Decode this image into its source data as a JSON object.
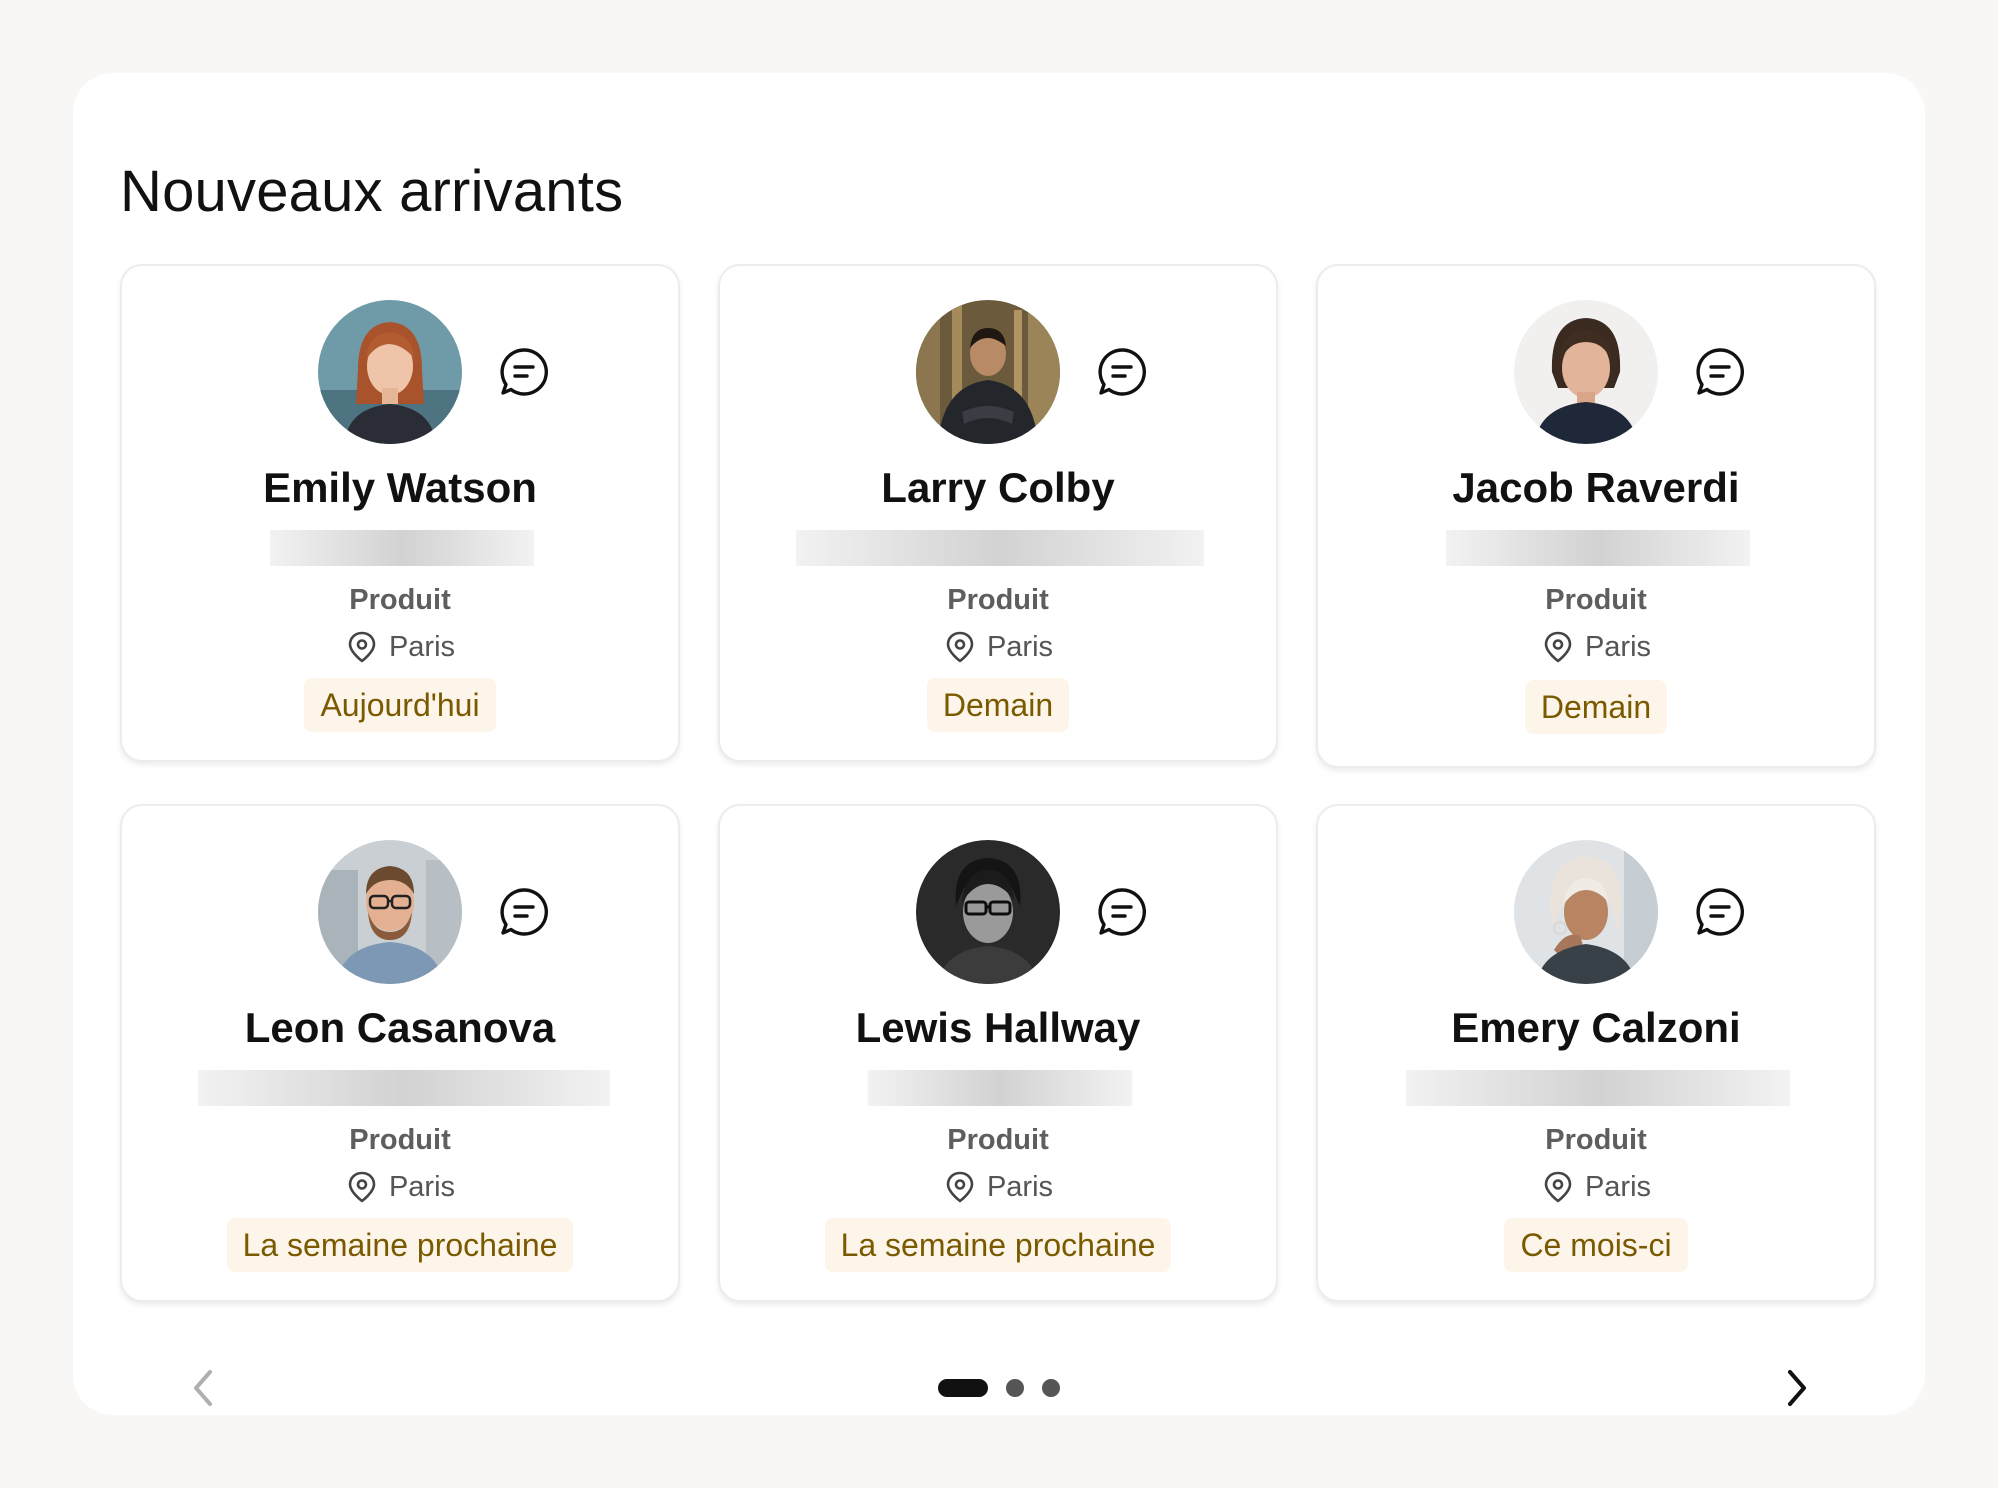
{
  "section_title": "Nouveaux arrivants",
  "colors": {
    "page_background": "#f8f7f5",
    "badge_background": "#fdf5e9",
    "badge_text": "#7a5a00",
    "active_dot": "#111111",
    "inactive_dot": "#555555"
  },
  "icons": {
    "message": "chat-bubble-icon",
    "location": "map-pin-icon",
    "previous": "chevron-left-icon",
    "next": "chevron-right-icon"
  },
  "cards": [
    {
      "name": "Emily Watson",
      "department": "Produit",
      "location": "Paris",
      "start": "Aujourd'hui"
    },
    {
      "name": "Larry Colby",
      "department": "Produit",
      "location": "Paris",
      "start": "Demain"
    },
    {
      "name": "Jacob Raverdi",
      "department": "Produit",
      "location": "Paris",
      "start": "Demain"
    },
    {
      "name": "Leon Casanova",
      "department": "Produit",
      "location": "Paris",
      "start": "La semaine prochaine"
    },
    {
      "name": "Lewis Hallway",
      "department": "Produit",
      "location": "Paris",
      "start": "La semaine prochaine"
    },
    {
      "name": "Emery Calzoni",
      "department": "Produit",
      "location": "Paris",
      "start": "Ce mois-ci"
    }
  ],
  "pagination": {
    "pages": 3,
    "current": 1
  }
}
